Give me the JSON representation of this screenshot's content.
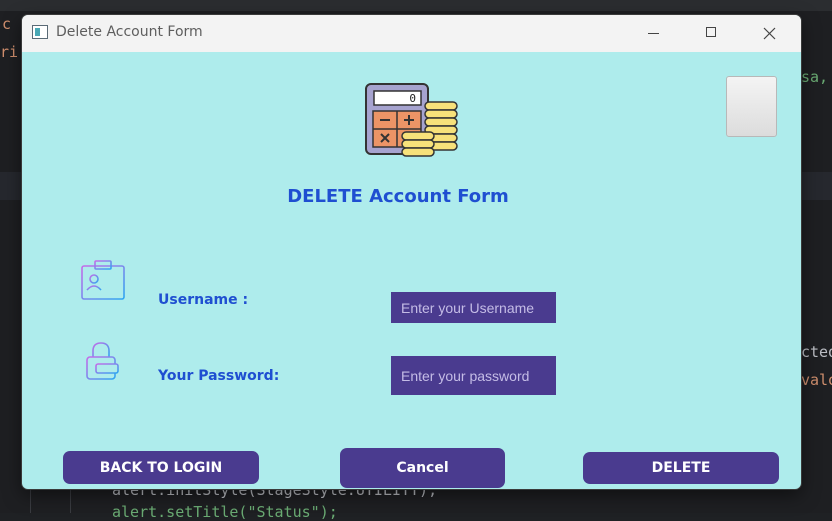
{
  "window": {
    "title": "Delete Account Form",
    "minimize_label": "Minimize",
    "maximize_label": "Maximize",
    "close_label": "Close"
  },
  "form": {
    "title": "DELETE Account Form",
    "username": {
      "label": "Username :",
      "placeholder": "Enter your Username",
      "value": ""
    },
    "password": {
      "label": "Your Password:",
      "placeholder": "Enter your password",
      "value": ""
    },
    "buttons": {
      "back": "BACK TO LOGIN",
      "cancel": "Cancel",
      "delete": "DELETE"
    },
    "calculator_display": "0"
  },
  "background_code": {
    "line1": "c",
    "line2": "ri",
    "right1": "sa,",
    "right2": "cted",
    "right3": "valo",
    "bottom1": "alert.initStyle(StageStyle.UTILITY);",
    "bottom2": "alert.setTitle(\"Status\");"
  },
  "colors": {
    "dialog_bg": "#aeecec",
    "accent": "#4a3b8f",
    "label_text": "#1f4fd1",
    "titlebar_bg": "#f3f3f3"
  },
  "icons": [
    "app-window-icon",
    "calculator-coins-icon",
    "id-card-icon",
    "lock-icon",
    "minimize-icon",
    "maximize-icon",
    "close-icon"
  ]
}
